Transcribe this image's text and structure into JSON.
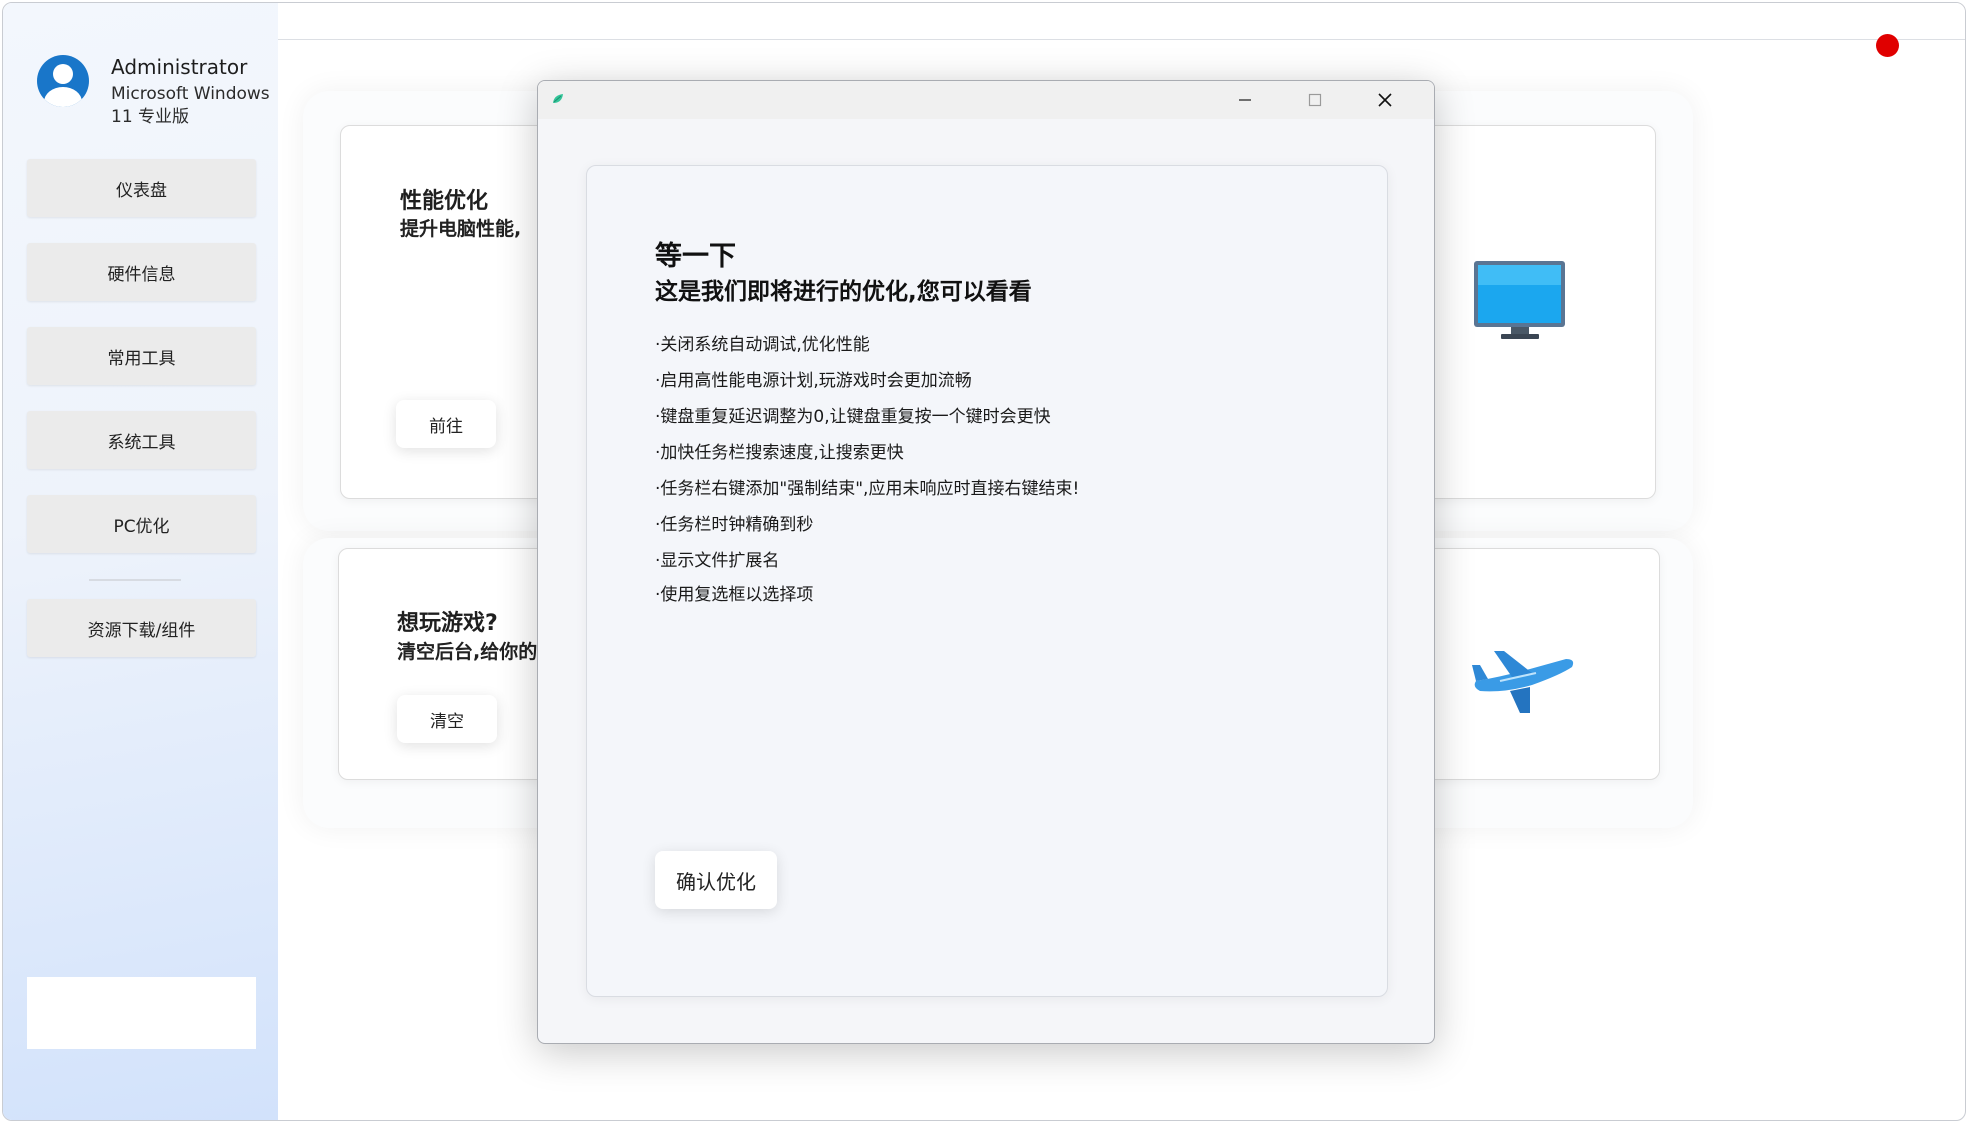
{
  "sidebar": {
    "user_name": "Administrator",
    "user_os": "Microsoft Windows 11 专业版",
    "nav": [
      {
        "label": "仪表盘"
      },
      {
        "label": "硬件信息"
      },
      {
        "label": "常用工具"
      },
      {
        "label": "系统工具"
      },
      {
        "label": "PC优化"
      },
      {
        "label": "资源下载/组件"
      }
    ]
  },
  "status": {
    "indicator_color": "#e00000"
  },
  "cards": {
    "performance": {
      "title": "性能优化",
      "subtitle": "提升电脑性能,",
      "button": "前往",
      "icon": "monitor-icon"
    },
    "game": {
      "title": "想玩游戏?",
      "subtitle": "清空后台,给你的",
      "button": "清空",
      "icon": "airplane-icon"
    }
  },
  "dialog": {
    "heading": "等一下",
    "subheading": "这是我们即将进行的优化,您可以看看",
    "items": [
      "·关闭系统自动调试,优化性能",
      "·启用高性能电源计划,玩游戏时会更加流畅",
      "·键盘重复延迟调整为0,让键盘重复按一个键时会更快",
      "·加快任务栏搜索速度,让搜索更快",
      "·任务栏右键添加\"强制结束\",应用未响应时直接右键结束!",
      "·任务栏时钟精确到秒",
      "·显示文件扩展名",
      "·使用复选框以选择项"
    ],
    "confirm_button": "确认优化"
  },
  "colors": {
    "accent": "#1976c9",
    "sidebar_gradient_end": "#d2e2fb",
    "button_bg": "#ebebeb"
  }
}
